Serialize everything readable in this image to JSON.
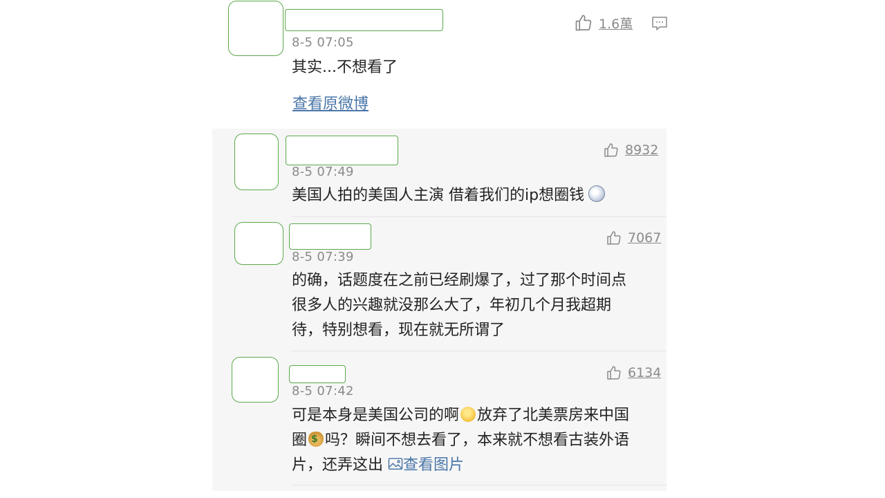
{
  "main_post": {
    "time": "8-5 07:05",
    "text": "其实...不想看了",
    "likes": "1.6萬",
    "view_original": "查看原微博"
  },
  "replies": [
    {
      "time": "8-5 07:49",
      "likes": "8932",
      "lines": [
        "美国人拍的美国人主演 借着我们的ip想圈钱"
      ],
      "emoji": "dizzy-face"
    },
    {
      "time": "8-5 07:39",
      "likes": "7067",
      "lines": [
        "的确，话题度在之前已经刷爆了，过了那个时间点",
        "很多人的兴趣就没那么大了，年初几个月我超期",
        "待，特别想看，现在就无所谓了"
      ]
    },
    {
      "time": "8-5 07:42",
      "likes": "6134",
      "line1a": "可是本身是美国公司的啊",
      "line1b": "放弃了北美票房来中国",
      "line2a": "圈",
      "line2b": "吗？瞬间不想去看了，本来就不想看古装外语",
      "line3a": "片，还弄这出",
      "view_image": "查看图片"
    }
  ],
  "icons": {
    "like": "thumbs-up-icon",
    "comment": "comment-icon",
    "image": "image-icon"
  },
  "colors": {
    "link": "#4a76a8",
    "muted": "#8a8a8a",
    "avatar_outline": "#5aa84a"
  }
}
